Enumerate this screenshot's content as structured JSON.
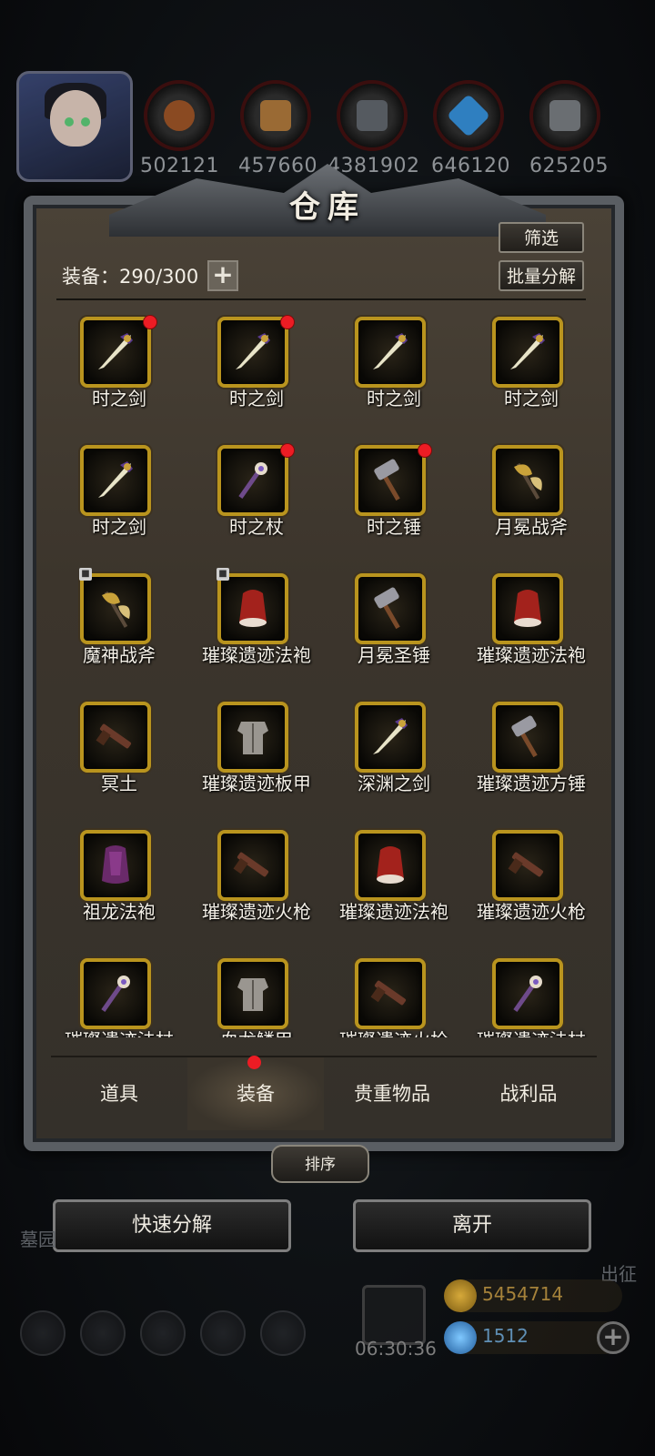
{
  "resources": [
    {
      "name": "wood-log-icon",
      "value": "502121",
      "color": "#8a4a22"
    },
    {
      "name": "plank-icon",
      "value": "457660",
      "color": "#9a6a34"
    },
    {
      "name": "iron-bar-icon",
      "value": "4381902",
      "color": "#555a60"
    },
    {
      "name": "crystal-icon",
      "value": "646120",
      "color": "#2f7fc0"
    },
    {
      "name": "steel-bar-icon",
      "value": "625205",
      "color": "#6a6e72"
    }
  ],
  "panel": {
    "title": "仓库",
    "filter_label": "筛选",
    "batch_label": "批量分解",
    "count_label": "装备：290/300"
  },
  "items": [
    {
      "name": "时之剑",
      "dot": true,
      "lock": false,
      "art": "sword"
    },
    {
      "name": "时之剑",
      "dot": true,
      "lock": false,
      "art": "sword"
    },
    {
      "name": "时之剑",
      "dot": false,
      "lock": false,
      "art": "sword"
    },
    {
      "name": "时之剑",
      "dot": false,
      "lock": false,
      "art": "sword"
    },
    {
      "name": "时之剑",
      "dot": false,
      "lock": false,
      "art": "sword"
    },
    {
      "name": "时之杖",
      "dot": true,
      "lock": false,
      "art": "staff"
    },
    {
      "name": "时之锤",
      "dot": true,
      "lock": false,
      "art": "hammer"
    },
    {
      "name": "月冕战斧",
      "dot": false,
      "lock": false,
      "art": "axe"
    },
    {
      "name": "魔神战斧",
      "dot": false,
      "lock": true,
      "art": "axe"
    },
    {
      "name": "璀璨遗迹法袍",
      "dot": false,
      "lock": true,
      "art": "robe"
    },
    {
      "name": "月冕圣锤",
      "dot": false,
      "lock": false,
      "art": "hammer"
    },
    {
      "name": "璀璨遗迹法袍",
      "dot": false,
      "lock": false,
      "art": "robe"
    },
    {
      "name": "冥土",
      "dot": false,
      "lock": false,
      "art": "gun"
    },
    {
      "name": "璀璨遗迹板甲",
      "dot": false,
      "lock": false,
      "art": "armor"
    },
    {
      "name": "深渊之剑",
      "dot": false,
      "lock": false,
      "art": "sword"
    },
    {
      "name": "璀璨遗迹方锤",
      "dot": false,
      "lock": false,
      "art": "hammer"
    },
    {
      "name": "祖龙法袍",
      "dot": false,
      "lock": false,
      "art": "robe2"
    },
    {
      "name": "璀璨遗迹火枪",
      "dot": false,
      "lock": false,
      "art": "gun"
    },
    {
      "name": "璀璨遗迹法袍",
      "dot": false,
      "lock": false,
      "art": "robe"
    },
    {
      "name": "璀璨遗迹火枪",
      "dot": false,
      "lock": false,
      "art": "gun"
    },
    {
      "name": "璀璨遗迹法杖",
      "dot": false,
      "lock": false,
      "art": "staff"
    },
    {
      "name": "血龙鳞甲",
      "dot": false,
      "lock": false,
      "art": "armor"
    },
    {
      "name": "璀璨遗迹火枪",
      "dot": false,
      "lock": false,
      "art": "gun"
    },
    {
      "name": "璀璨遗迹法杖",
      "dot": false,
      "lock": false,
      "art": "staff"
    }
  ],
  "tabs": [
    "道具",
    "装备",
    "贵重物品",
    "战利品"
  ],
  "active_tab": 1,
  "sort_label": "排序",
  "quick_decompose_label": "快速分解",
  "leave_label": "离开",
  "background": {
    "left_text": "墓园",
    "right_text": "出征",
    "timer": "06:30:36",
    "gold": "5454714",
    "gems": "1512"
  }
}
